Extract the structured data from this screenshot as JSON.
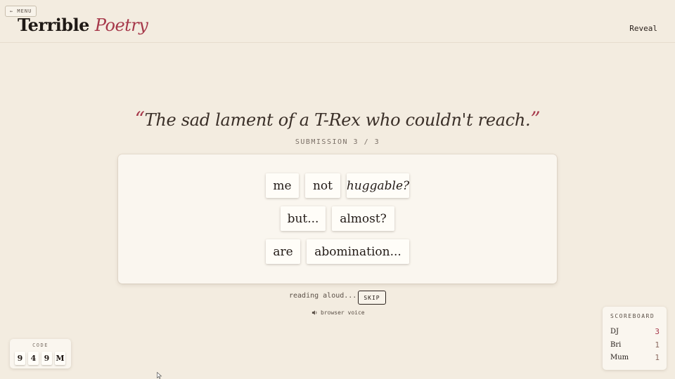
{
  "header": {
    "menu_label": "← MENU",
    "logo_word": "Terrible",
    "logo_accent": "Poetry",
    "reveal_label": "Reveal"
  },
  "prompt": {
    "open_quote": "“",
    "text": "The sad lament of a T-Rex who couldn't reach.",
    "close_quote": "”"
  },
  "submission_label": "SUBMISSION 3 / 3",
  "tiles": [
    "me",
    "not",
    "huggable?",
    "but...",
    "almost?",
    "are",
    "abomination..."
  ],
  "playback": {
    "status": "reading aloud...",
    "skip_label": "SKIP",
    "voice_label": "browser voice",
    "voice_icon": "speaker-icon"
  },
  "room_code": {
    "label": "CODE",
    "chars": [
      "9",
      "4",
      "9",
      "M"
    ]
  },
  "scoreboard": {
    "title": "SCOREBOARD",
    "rows": [
      {
        "name": "DJ",
        "score": "3"
      },
      {
        "name": "Bri",
        "score": "1"
      },
      {
        "name": "Mum",
        "score": "1"
      }
    ]
  },
  "colors": {
    "background": "#f3ece0",
    "accent": "#a6384a",
    "board": "#faf6ef",
    "tile": "#fffdf8"
  }
}
